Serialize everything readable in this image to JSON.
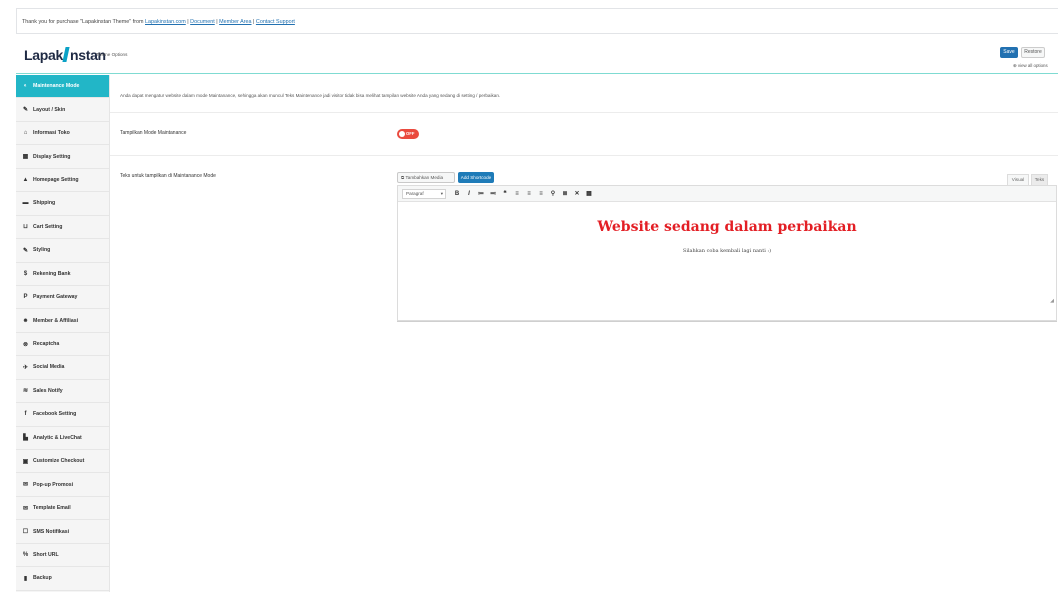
{
  "notice": {
    "prefix": "Thank you for purchase \"Lapakinstan Theme\" from",
    "link_store": "Lapakinstan.com",
    "sep1": "|",
    "link_document": "Document",
    "sep2": "|",
    "link_member": "Member Area",
    "sep3": "|",
    "link_support": "Contact Support"
  },
  "header": {
    "logo_part1": "Lapak",
    "logo_part2": "nstan",
    "subtitle": "Theme Options",
    "save_label": "Save",
    "restore_label": "Restore",
    "view_all_label": "⊕ view all options"
  },
  "sidebar": {
    "items": [
      {
        "icon": "◐",
        "label": "Maintenance Mode"
      },
      {
        "icon": "✎",
        "label": "Layout / Skin"
      },
      {
        "icon": "⌂",
        "label": "Informasi Toko"
      },
      {
        "icon": "▦",
        "label": "Display Setting"
      },
      {
        "icon": "▲",
        "label": "Homepage Setting"
      },
      {
        "icon": "▬",
        "label": "Shipping"
      },
      {
        "icon": "⊔",
        "label": "Cart Setting"
      },
      {
        "icon": "✎",
        "label": "Styling"
      },
      {
        "icon": "$",
        "label": "Rekening Bank"
      },
      {
        "icon": "P",
        "label": "Payment Gateway"
      },
      {
        "icon": "☻",
        "label": "Member & Affiliasi"
      },
      {
        "icon": "⊗",
        "label": "Recaptcha"
      },
      {
        "icon": "✈",
        "label": "Social Media"
      },
      {
        "icon": "≋",
        "label": "Sales Notify"
      },
      {
        "icon": "f",
        "label": "Facebook Setting"
      },
      {
        "icon": "▙",
        "label": "Analytic & LiveChat"
      },
      {
        "icon": "▣",
        "label": "Customize Checkout"
      },
      {
        "icon": "✉",
        "label": "Pop-up Promosi"
      },
      {
        "icon": "✉",
        "label": "Template Email"
      },
      {
        "icon": "☐",
        "label": "SMS Notifikasi"
      },
      {
        "icon": "%",
        "label": "Short URL"
      },
      {
        "icon": "▮",
        "label": "Backup"
      }
    ]
  },
  "main": {
    "description": "Anda dapat mengatur website dalam mode Maintanance, sehingga akan muncul Teks Maintenance jadi visitor tidak bisa melihat tampilan website Anda yang sedang di setting / perbaikan.",
    "field1_label": "Tampilkan Mode Maintanance",
    "toggle_state": "OFF",
    "field2_label": "Teks untuk tampilkan di Maintanance Mode",
    "media_button": "Tambahkan Media",
    "shortcode_button": "Add Shortcode",
    "tab_visual": "Visual",
    "tab_teks": "Teks",
    "paragraph_select": "Paragraf",
    "toolbar_icons": [
      "B",
      "I",
      "≔",
      "≕",
      "❝",
      "≡",
      "≡",
      "≡",
      "⚲",
      "≣",
      "✕",
      "▦"
    ],
    "editor_title": "Website sedang dalam perbaikan",
    "editor_subtitle": "Silahkan coba kembali lagi nanti :)"
  },
  "colors": {
    "accent": "#22b6c7",
    "primary_button": "#2271b1",
    "toggle_off": "#ea4a3e",
    "editor_title": "#e31e24"
  }
}
